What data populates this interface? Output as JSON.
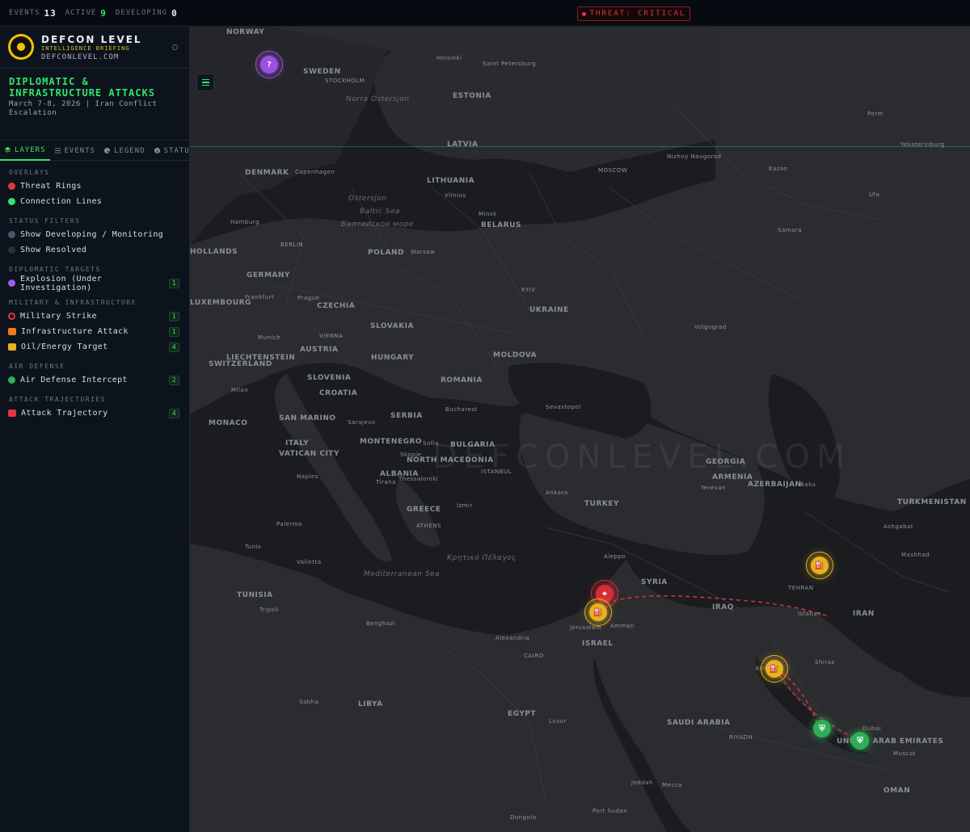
{
  "topbar": {
    "stats": [
      {
        "label": "EVENTS",
        "value": "13"
      },
      {
        "label": "ACTIVE",
        "value": "9"
      },
      {
        "label": "DEVELOPING",
        "value": "0"
      }
    ],
    "threat": "THREAT: CRITICAL"
  },
  "brand": {
    "name": "DEFCON LEVEL",
    "subtitle": "INTELLIGENCE BRIEFING",
    "url": "DEFCONLEVEL.COM",
    "logo_text": "DEF CON"
  },
  "briefing": {
    "title": "DIPLOMATIC & INFRASTRUCTURE ATTACKS",
    "date": "March 7-8, 2026 | Iran Conflict Escalation"
  },
  "tabs": [
    {
      "label": "LAYERS",
      "icon": "layers-icon",
      "active": true
    },
    {
      "label": "EVENTS",
      "icon": "list-icon",
      "active": false
    },
    {
      "label": "LEGEND",
      "icon": "palette-icon",
      "active": false
    },
    {
      "label": "STATUS",
      "icon": "info-icon",
      "active": false
    }
  ],
  "layers": {
    "overlays_title": "OVERLAYS",
    "overlays": [
      {
        "label": "Threat Rings",
        "color": "#e2353f"
      },
      {
        "label": "Connection Lines",
        "color": "#33e36a"
      }
    ],
    "status_title": "STATUS FILTERS",
    "status": [
      {
        "label": "Show Developing / Monitoring",
        "color": "#4d5866"
      },
      {
        "label": "Show Resolved",
        "color": "#2a323d"
      }
    ],
    "diplomatic_title": "DIPLOMATIC TARGETS",
    "diplomatic": [
      {
        "label": "Explosion (Under Investigation)",
        "count": "1",
        "color": "#a45ce8"
      }
    ],
    "military_title": "MILITARY & INFRASTRUCTURE",
    "military": [
      {
        "label": "Military Strike",
        "count": "1",
        "color": "#e2353f",
        "icon": "crosshair-icon"
      },
      {
        "label": "Infrastructure Attack",
        "count": "1",
        "color": "#f07a1e",
        "icon": "factory-icon"
      },
      {
        "label": "Oil/Energy Target",
        "count": "4",
        "color": "#e8b21c",
        "icon": "oil-pump-icon"
      }
    ],
    "air_title": "AIR DEFENSE",
    "air": [
      {
        "label": "Air Defense Intercept",
        "count": "2",
        "color": "#2fae55",
        "icon": "shield-icon"
      }
    ],
    "traj_title": "ATTACK TRAJECTORIES",
    "traj": [
      {
        "label": "Attack Trajectory",
        "count": "4",
        "color": "#e2353f",
        "icon": "missile-icon"
      }
    ]
  },
  "map": {
    "watermark": "DEFCONLEVEL.COM",
    "countries": [
      "NORWAY",
      "SWEDEN",
      "ESTONIA",
      "LATVIA",
      "LITHUANIA",
      "DENMARK",
      "BELARUS",
      "POLAND",
      "GERMANY",
      "CZECHIA",
      "UKRAINE",
      "SLOVAKIA",
      "AUSTRIA",
      "HUNGARY",
      "MOLDOVA",
      "ROMANIA",
      "SLOVENIA",
      "CROATIA",
      "SERBIA",
      "BULGARIA",
      "MONTENEGRO",
      "ITALY",
      "GREECE",
      "TURKEY",
      "GEORGIA",
      "ARMENIA",
      "AZERBAIJAN",
      "TURKMENISTAN",
      "SYRIA",
      "IRAQ",
      "IRAN",
      "ISRAEL",
      "EGYPT",
      "LIBYA",
      "SAUDI ARABIA",
      "TUNISIA",
      "OMAN",
      "SWITZERLAND",
      "LIECHTENSTEIN",
      "NORTH MACEDONIA",
      "ALBANIA",
      "SAN MARINO",
      "VATICAN CITY",
      "MONACO",
      "LUXEMBOURG",
      "UNITED ARAB EMIRATES",
      "HOLLANDS"
    ],
    "cities": [
      "Helsinki",
      "Saint Petersburg",
      "STOCKHOLM",
      "Perm",
      "Yekaterinburg",
      "Nizhny Novgorod",
      "MOSCOW",
      "Kazan",
      "Ufa",
      "Copenhagen",
      "Vilnius",
      "Minsk",
      "Samara",
      "Hamburg",
      "BERLIN",
      "Warsaw",
      "Frankfurt",
      "Prague",
      "KYIV",
      "Munich",
      "VIENNA",
      "Volgograd",
      "Milan",
      "Sarajevo",
      "Bucharest",
      "Sevastopol",
      "Sofia",
      "Skopje",
      "Thessaloniki",
      "Tirana",
      "ISTANBUL",
      "Naples",
      "Palermo",
      "ATHENS",
      "Ankara",
      "Izmir",
      "Yerevan",
      "Baku",
      "Ashgabat",
      "Mashhad",
      "Tunis",
      "Valletta",
      "Aleppo",
      "Tripoli",
      "Benghazi",
      "Alexandria",
      "CAIRO",
      "Jerusalem",
      "Amman",
      "Isfahan",
      "Shiraz",
      "Sabha",
      "Luxor",
      "RIYADH",
      "Dubai",
      "Muscat",
      "Jeddah",
      "Mecca",
      "Port Sudan",
      "Dongola",
      "TEHRAN",
      "KUWAIT"
    ],
    "seas": [
      "Norra Ostersjon",
      "Ostersjon",
      "Baltic Sea",
      "Балтийское море",
      "Mediterranean Sea",
      "Κρητικό Πέλαγος"
    ],
    "markers": [
      {
        "type": "explosion",
        "icon": "question-icon",
        "glyph": "?"
      },
      {
        "type": "military-strike",
        "icon": "crosshair-icon",
        "glyph": "⌖"
      },
      {
        "type": "oil-energy",
        "icon": "oil-pump-icon",
        "glyph": "⛽"
      },
      {
        "type": "oil-energy",
        "icon": "oil-pump-icon",
        "glyph": "⛽"
      },
      {
        "type": "oil-energy",
        "icon": "oil-pump-icon",
        "glyph": "⛽"
      },
      {
        "type": "air-defense",
        "icon": "shield-icon",
        "glyph": "⛨"
      },
      {
        "type": "air-defense",
        "icon": "shield-icon",
        "glyph": "⛨"
      }
    ]
  }
}
